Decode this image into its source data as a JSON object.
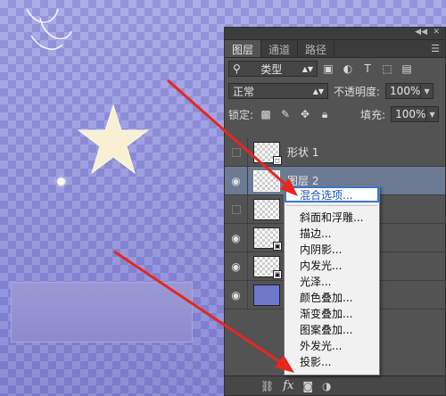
{
  "panel": {
    "tabs": [
      {
        "label": "图层"
      },
      {
        "label": "通道"
      },
      {
        "label": "路径"
      }
    ],
    "filter_kind": "类型",
    "blend_mode": "正常",
    "opacity_label": "不透明度:",
    "opacity_value": "100%",
    "lock_label": "锁定:",
    "fill_label": "填充:",
    "fill_value": "100%"
  },
  "layers": [
    {
      "name": "形状 1",
      "visible": false,
      "selected": false
    },
    {
      "name": "图层 2",
      "visible": true,
      "selected": true
    },
    {
      "name": "",
      "visible": false,
      "selected": false
    },
    {
      "name": "",
      "visible": true,
      "selected": false
    },
    {
      "name": "",
      "visible": true,
      "selected": false
    },
    {
      "name": "",
      "visible": true,
      "selected": false
    }
  ],
  "context_menu": {
    "items": [
      {
        "label": "混合选项..."
      },
      {
        "label": "斜面和浮雕..."
      },
      {
        "label": "描边..."
      },
      {
        "label": "内阴影..."
      },
      {
        "label": "内发光..."
      },
      {
        "label": "光泽..."
      },
      {
        "label": "颜色叠加..."
      },
      {
        "label": "渐变叠加..."
      },
      {
        "label": "图案叠加..."
      },
      {
        "label": "外发光..."
      },
      {
        "label": "投影..."
      }
    ]
  },
  "bottom_bar": {
    "fx_label": "fx"
  },
  "colors": {
    "arrow": "#e8261e",
    "panel_bg": "#535353",
    "selection": "#6c7a94",
    "menu_highlight_border": "#3a74d6"
  }
}
